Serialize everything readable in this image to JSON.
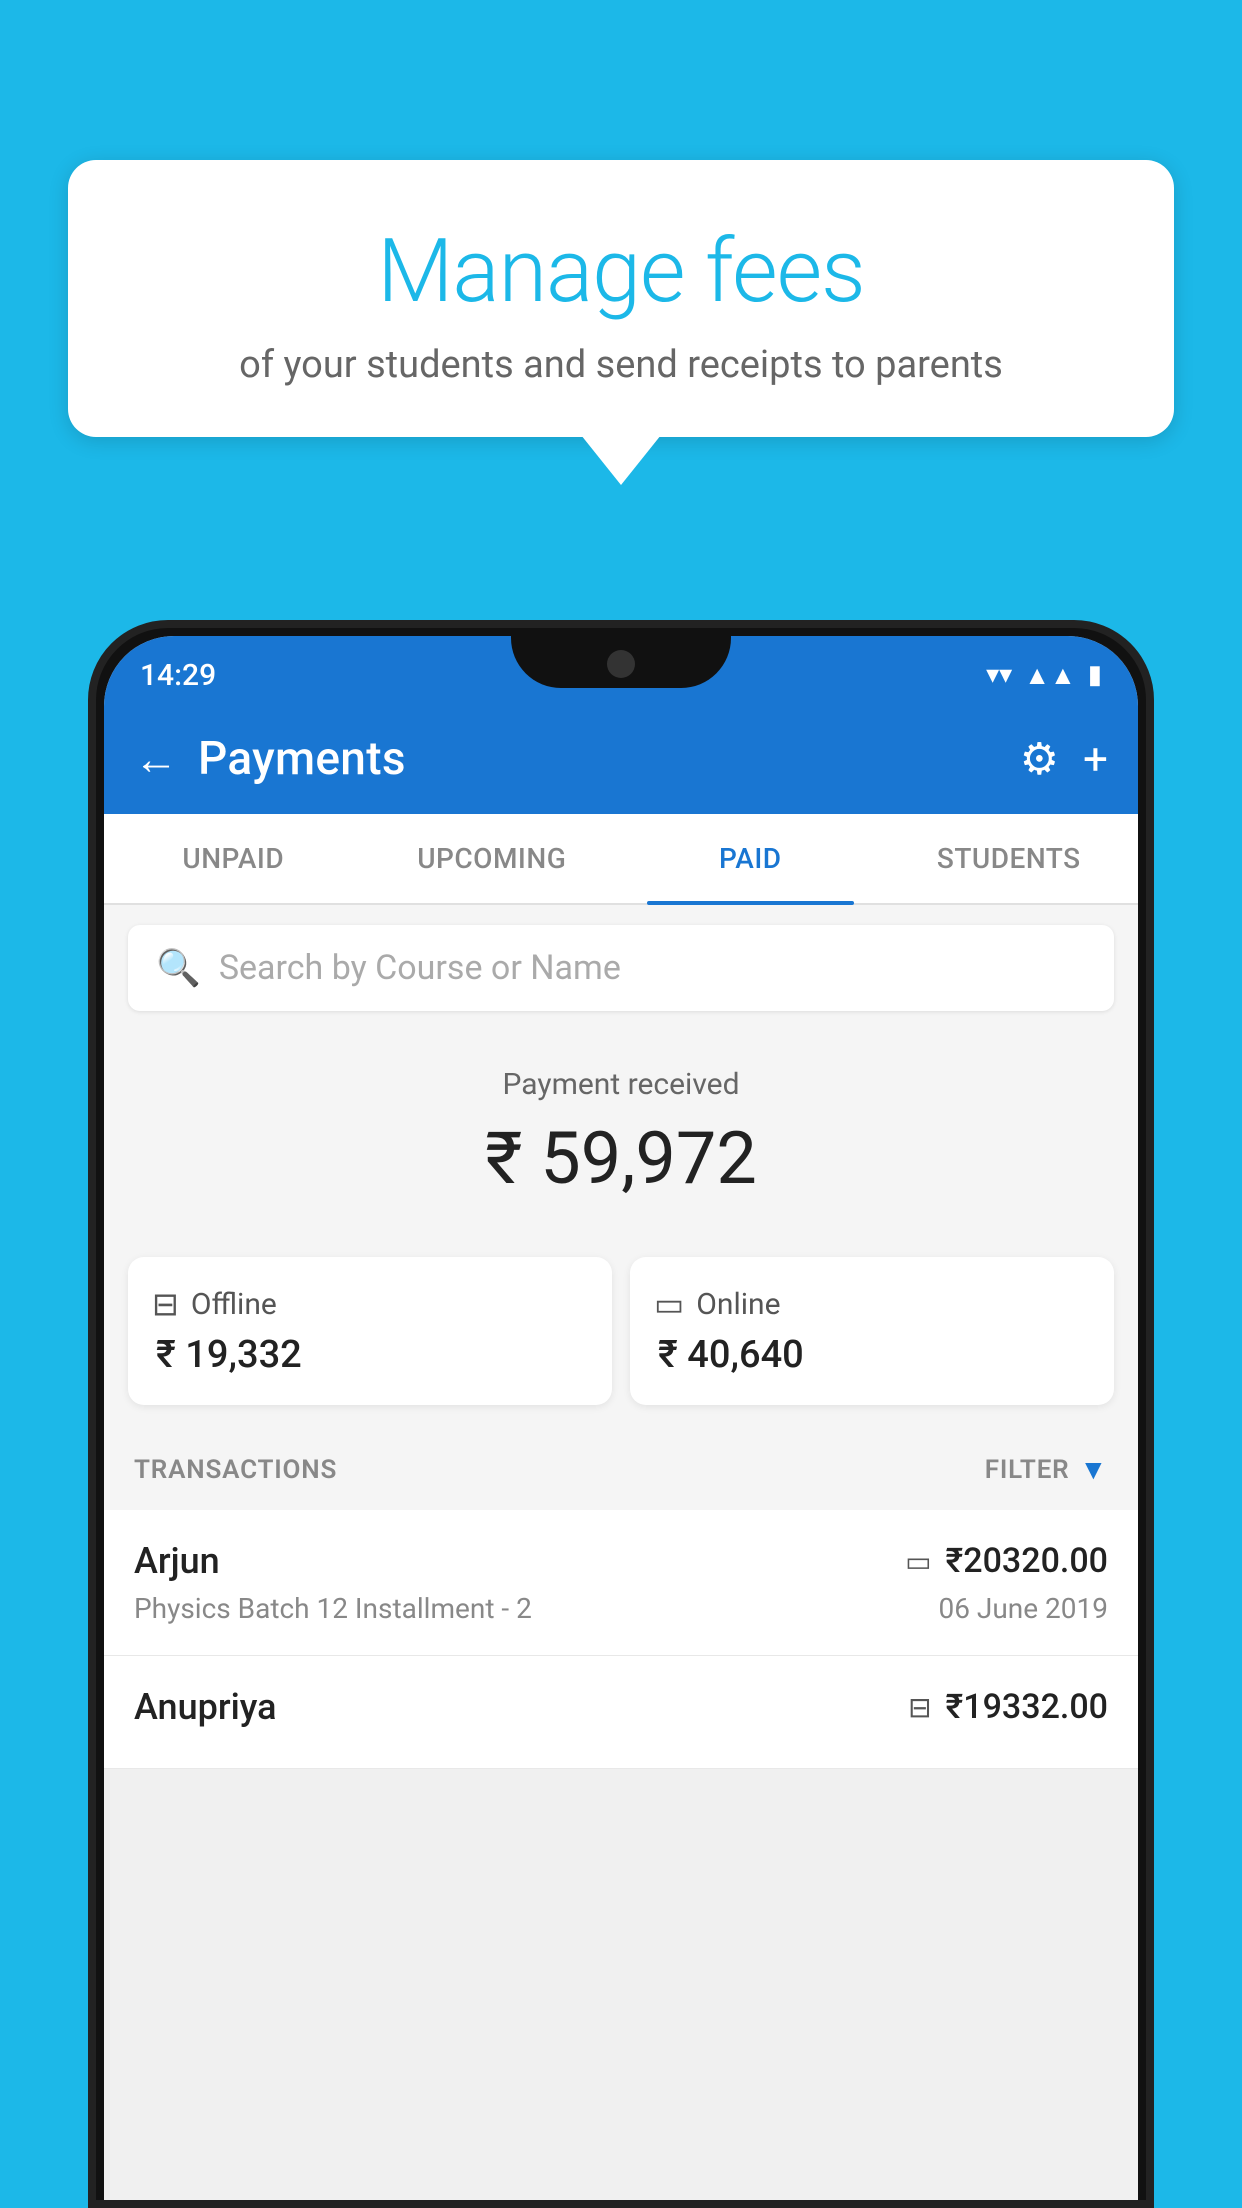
{
  "background_color": "#1cb8e8",
  "bubble": {
    "title": "Manage fees",
    "subtitle": "of your students and send receipts to parents"
  },
  "status_bar": {
    "time": "14:29",
    "wifi_icon": "▼",
    "signal_icon": "▲",
    "battery_icon": "▮"
  },
  "app_bar": {
    "title": "Payments",
    "back_label": "←",
    "gear_label": "⚙",
    "plus_label": "+"
  },
  "tabs": [
    {
      "id": "unpaid",
      "label": "UNPAID",
      "active": false
    },
    {
      "id": "upcoming",
      "label": "UPCOMING",
      "active": false
    },
    {
      "id": "paid",
      "label": "PAID",
      "active": true
    },
    {
      "id": "students",
      "label": "STUDENTS",
      "active": false
    }
  ],
  "search": {
    "placeholder": "Search by Course or Name"
  },
  "payment_summary": {
    "label": "Payment received",
    "amount": "₹ 59,972",
    "offline": {
      "icon": "offline",
      "label": "Offline",
      "amount": "₹ 19,332"
    },
    "online": {
      "icon": "online",
      "label": "Online",
      "amount": "₹ 40,640"
    }
  },
  "transactions_label": "TRANSACTIONS",
  "filter_label": "FILTER",
  "transactions": [
    {
      "name": "Arjun",
      "course": "Physics Batch 12 Installment - 2",
      "amount": "₹20320.00",
      "date": "06 June 2019",
      "payment_type": "online"
    },
    {
      "name": "Anupriya",
      "course": "",
      "amount": "₹19332.00",
      "date": "",
      "payment_type": "offline"
    }
  ]
}
